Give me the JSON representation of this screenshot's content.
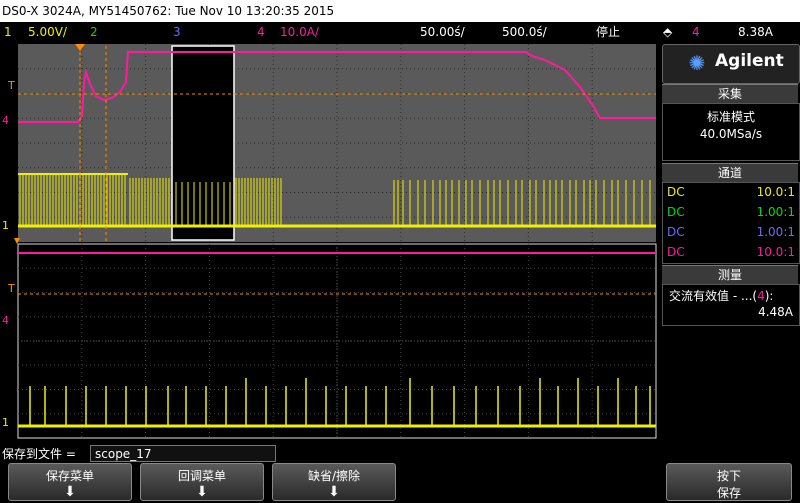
{
  "title": "DS0-X 3024A, MY51450762: Tue Nov 10 13:20:35 2015",
  "status": {
    "ch1_num": "1",
    "ch1_scale": "5.00V/",
    "ch2_num": "2",
    "ch3_num": "3",
    "ch4_num": "4",
    "ch4_scale": "10.0A/",
    "time_ref": "50.00ś/",
    "time_scale": "500.0ś/",
    "run_state": "停止",
    "trig_num": "4",
    "trig_level": "8.38A"
  },
  "colors": {
    "ch1": "#f0f000",
    "ch2": "#00e000",
    "ch3": "#6a6aff",
    "ch4": "#ff1aa0",
    "accent": "#ff8c00"
  },
  "panel": {
    "logo": "Agilent",
    "logo_icon": "agilent-spark-icon",
    "acq_header": "采集",
    "acq_mode": "标准模式",
    "acq_rate": "40.0MSa/s",
    "chan_header": "通道",
    "channels": [
      {
        "coupling": "DC",
        "ratio": "10.0:1"
      },
      {
        "coupling": "DC",
        "ratio": "1.00:1"
      },
      {
        "coupling": "DC",
        "ratio": "1.00:1"
      },
      {
        "coupling": "DC",
        "ratio": "10.0:1"
      }
    ],
    "meas_header": "测量",
    "meas_label_a": "交流有效值 - ...(",
    "meas_label_ch": "4",
    "meas_label_b": "):",
    "meas_value": "4.48A"
  },
  "save": {
    "label": "保存到文件 =",
    "filename": "scope_17"
  },
  "softkeys": {
    "k1": "保存菜单",
    "k2": "回调菜单",
    "k3": "缺省/擦除",
    "k4_top": "按下",
    "k4_bottom": "保存",
    "arrow": "⬇"
  },
  "markers": {
    "t": "T",
    "ch4": "4",
    "ch1": "1"
  }
}
